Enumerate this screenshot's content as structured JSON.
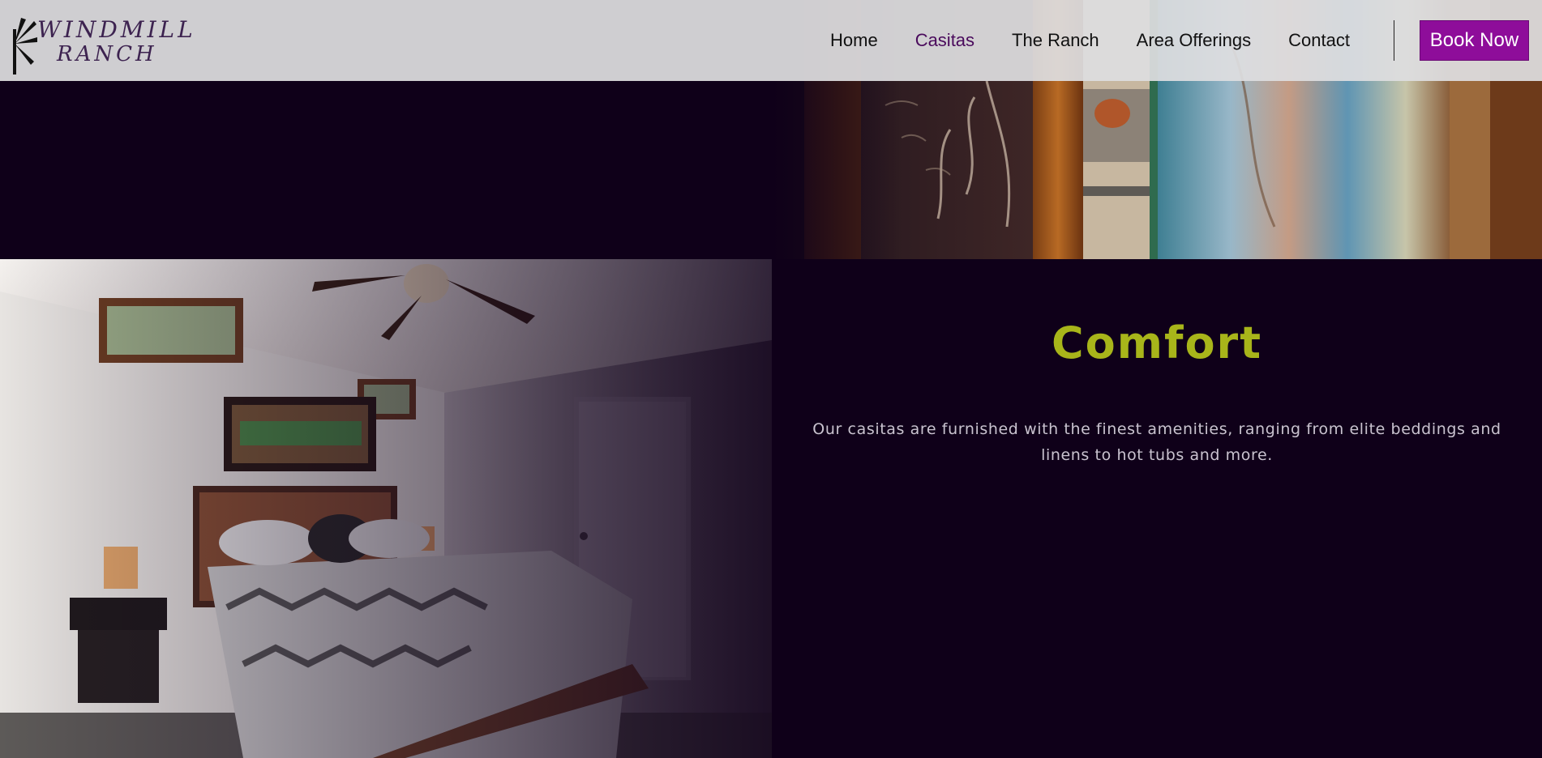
{
  "brand": {
    "name_line1": "WINDMILL",
    "name_line2": "RANCH"
  },
  "nav": {
    "items": [
      {
        "label": "Home",
        "active": false
      },
      {
        "label": "Casitas",
        "active": true
      },
      {
        "label": "The Ranch",
        "active": false
      },
      {
        "label": "Area Offerings",
        "active": false
      },
      {
        "label": "Contact",
        "active": false
      }
    ],
    "book_label": "Book Now"
  },
  "section": {
    "title": "Comfort",
    "body": "Our casitas are furnished with the finest amenities, ranging from elite beddings and linens to hot tubs and more."
  },
  "colors": {
    "background": "#0f0019",
    "accent_title": "#a8b51a",
    "book_button": "#8e0d9a",
    "nav_active": "#4a0a5c",
    "header_bg": "#dedee0"
  }
}
